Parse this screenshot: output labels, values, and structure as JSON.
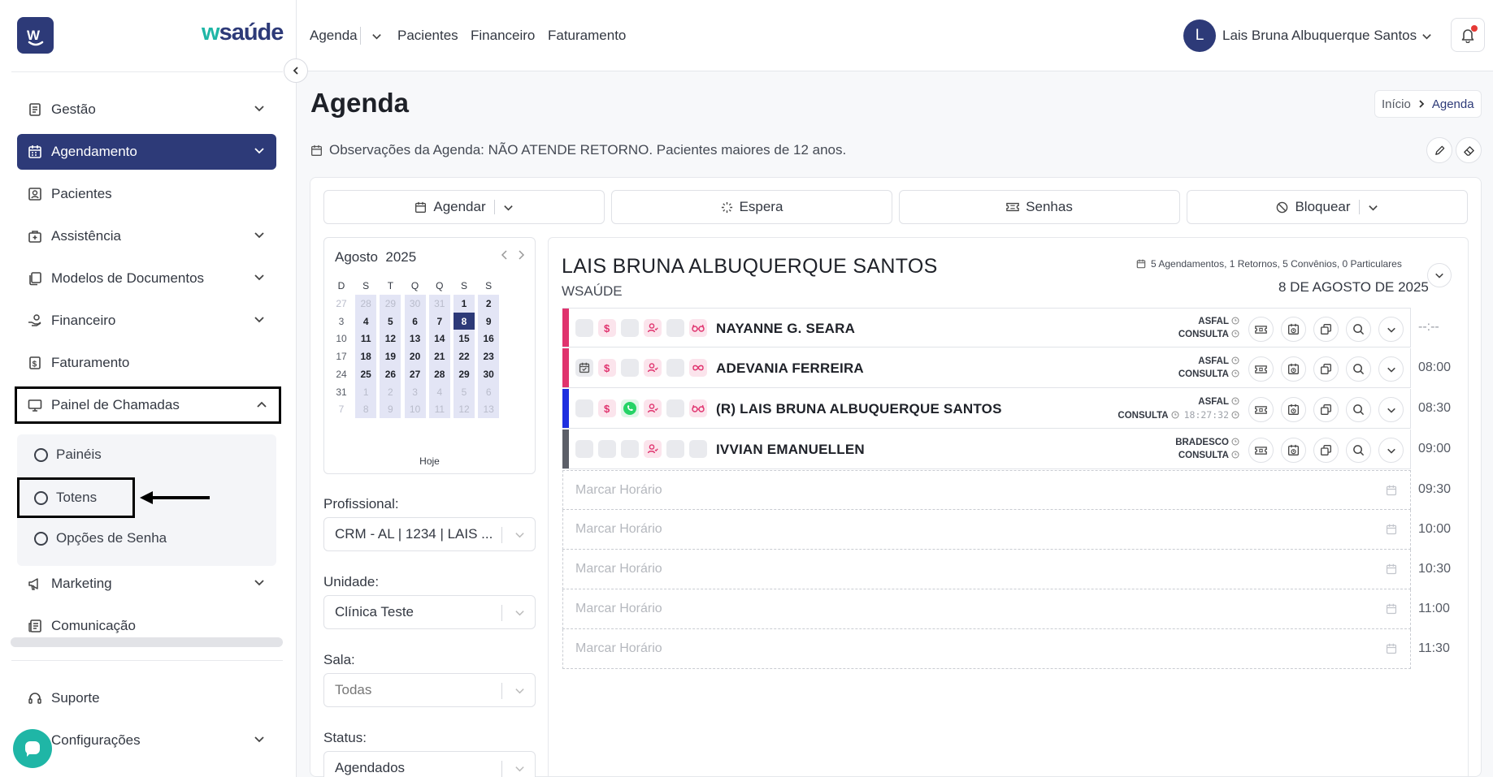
{
  "brand": {
    "logo_letter": "W",
    "name_prefix": "w",
    "name_rest": "saúde"
  },
  "sidebar": {
    "items": [
      {
        "label": "Gestão",
        "icon": "document-icon"
      },
      {
        "label": "Agendamento",
        "icon": "calendar-icon"
      },
      {
        "label": "Pacientes",
        "icon": "patient-icon"
      },
      {
        "label": "Assistência",
        "icon": "medical-bag-icon"
      },
      {
        "label": "Modelos de Documentos",
        "icon": "copy-icon"
      },
      {
        "label": "Financeiro",
        "icon": "hand-coin-icon"
      },
      {
        "label": "Faturamento",
        "icon": "dollar-doc-icon"
      },
      {
        "label": "Painel de Chamadas",
        "icon": "monitor-icon"
      },
      {
        "label": "Marketing",
        "icon": "megaphone-icon"
      },
      {
        "label": "Comunicação",
        "icon": "newspaper-icon"
      }
    ],
    "sub_items": [
      {
        "label": "Painéis"
      },
      {
        "label": "Totens"
      },
      {
        "label": "Opções de Senha"
      }
    ],
    "footer": [
      {
        "label": "Suporte",
        "icon": "headset-icon"
      },
      {
        "label": "Configurações",
        "icon": "gear-icon"
      }
    ]
  },
  "topbar": {
    "links": [
      "Agenda",
      "Pacientes",
      "Financeiro",
      "Faturamento"
    ],
    "user_initial": "L",
    "user_name": "Lais Bruna Albuquerque Santos"
  },
  "page": {
    "title": "Agenda",
    "breadcrumb_home": "Início",
    "breadcrumb_current": "Agenda",
    "observations": "Observações da Agenda: NÃO ATENDE RETORNO. Pacientes maiores de 12 anos."
  },
  "actions": {
    "schedule": "Agendar",
    "wait": "Espera",
    "tickets": "Senhas",
    "block": "Bloquear"
  },
  "calendar": {
    "month": "Agosto",
    "year": "2025",
    "weekdays": [
      "D",
      "S",
      "T",
      "Q",
      "Q",
      "S",
      "S"
    ],
    "weeks": [
      [
        "27",
        "28",
        "29",
        "30",
        "31",
        "1",
        "2"
      ],
      [
        "3",
        "4",
        "5",
        "6",
        "7",
        "8",
        "9"
      ],
      [
        "10",
        "11",
        "12",
        "13",
        "14",
        "15",
        "16"
      ],
      [
        "17",
        "18",
        "19",
        "20",
        "21",
        "22",
        "23"
      ],
      [
        "24",
        "25",
        "26",
        "27",
        "28",
        "29",
        "30"
      ],
      [
        "31",
        "1",
        "2",
        "3",
        "4",
        "5",
        "6"
      ],
      [
        "7",
        "8",
        "9",
        "10",
        "11",
        "12",
        "13"
      ]
    ],
    "selected_day": "8",
    "today_label": "Hoje"
  },
  "filters": {
    "professional_label": "Profissional:",
    "professional_value": "CRM - AL | 1234 | LAIS ...",
    "unit_label": "Unidade:",
    "unit_value": "Clínica Teste",
    "room_label": "Sala:",
    "room_value": "Todas",
    "status_label": "Status:",
    "status_value": "Agendados"
  },
  "schedule": {
    "doctor": "LAIS BRUNA ALBUQUERQUE SANTOS",
    "unit": "WSAÚDE",
    "stats": "5 Agendamentos, 1 Retornos, 5 Convênios, 0 Particulares",
    "date": "8 DE AGOSTO DE 2025",
    "appointments": [
      {
        "name": "NAYANNE G. SEARA",
        "plan": "ASFAL",
        "type": "CONSULTA",
        "time": "--:--",
        "time_extra": "",
        "color": "#e0336e"
      },
      {
        "name": "ADEVANIA FERREIRA",
        "plan": "ASFAL",
        "type": "CONSULTA",
        "time": "08:00",
        "time_extra": "",
        "color": "#e0336e"
      },
      {
        "name": "(R) LAIS BRUNA ALBUQUERQUE SANTOS",
        "plan": "ASFAL",
        "type": "CONSULTA",
        "time": "08:30",
        "time_extra": "18:27:32",
        "color": "#1f2fe0"
      },
      {
        "name": "IVVIAN EMANUELLEN",
        "plan": "BRADESCO",
        "type": "CONSULTA",
        "time": "09:00",
        "time_extra": "",
        "color": "#5c5f68"
      }
    ],
    "empty_slots": [
      {
        "label": "Marcar Horário",
        "time": "09:30"
      },
      {
        "label": "Marcar Horário",
        "time": "10:00"
      },
      {
        "label": "Marcar Horário",
        "time": "10:30"
      },
      {
        "label": "Marcar Horário",
        "time": "11:00"
      },
      {
        "label": "Marcar Horário",
        "time": "11:30"
      }
    ]
  }
}
